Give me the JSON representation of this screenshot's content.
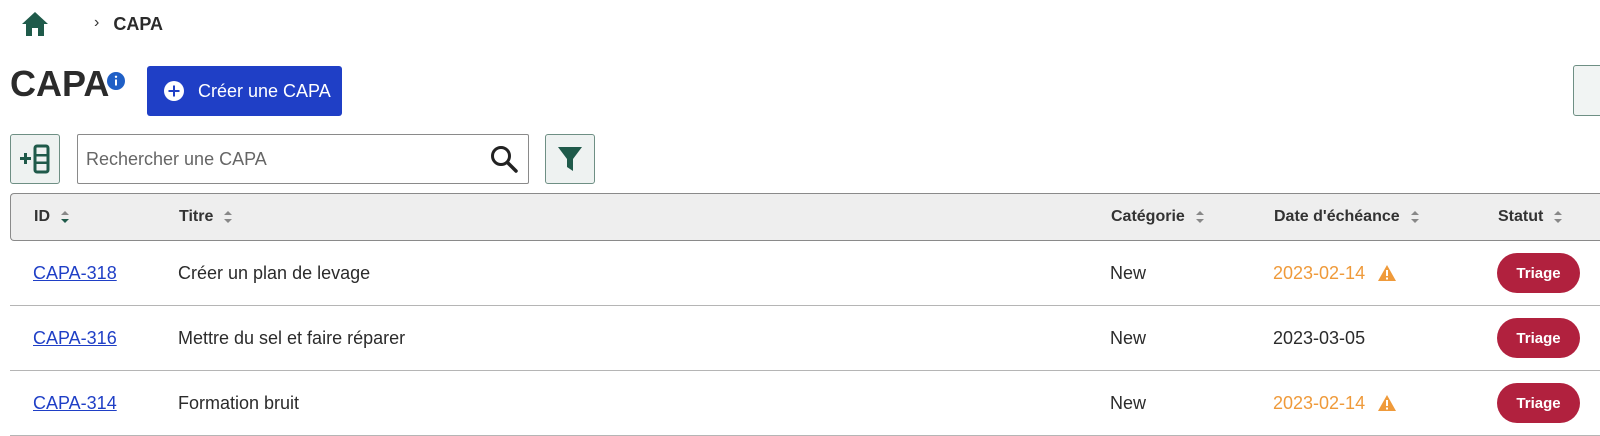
{
  "breadcrumb": {
    "separator": "›",
    "current": "CAPA"
  },
  "header": {
    "title": "CAPA",
    "create_button_label": "Créer une CAPA"
  },
  "search": {
    "placeholder": "Rechercher une CAPA",
    "value": ""
  },
  "table": {
    "columns": [
      "ID",
      "Titre",
      "Catégorie",
      "Date d'échéance",
      "Statut"
    ],
    "rows": [
      {
        "id": "CAPA-318",
        "title": "Créer un plan de levage",
        "category": "New",
        "due_date": "2023-02-14",
        "status": "Triage"
      },
      {
        "id": "CAPA-316",
        "title": "Mettre du sel et faire réparer",
        "category": "New",
        "due_date": "2023-03-05",
        "status": "Triage"
      },
      {
        "id": "CAPA-314",
        "title": "Formation bruit",
        "category": "New",
        "due_date": "2023-02-14",
        "status": "Triage"
      }
    ]
  },
  "colors": {
    "primary": "#1f3fc6",
    "status_triage": "#b1213e",
    "overdue": "#ef9a3a",
    "icon_green": "#1f5a4a"
  },
  "icons": [
    "home-icon",
    "info-icon",
    "plus-circle-icon",
    "add-column-icon",
    "search-icon",
    "filter-icon",
    "sort-icon",
    "warning-icon"
  ]
}
